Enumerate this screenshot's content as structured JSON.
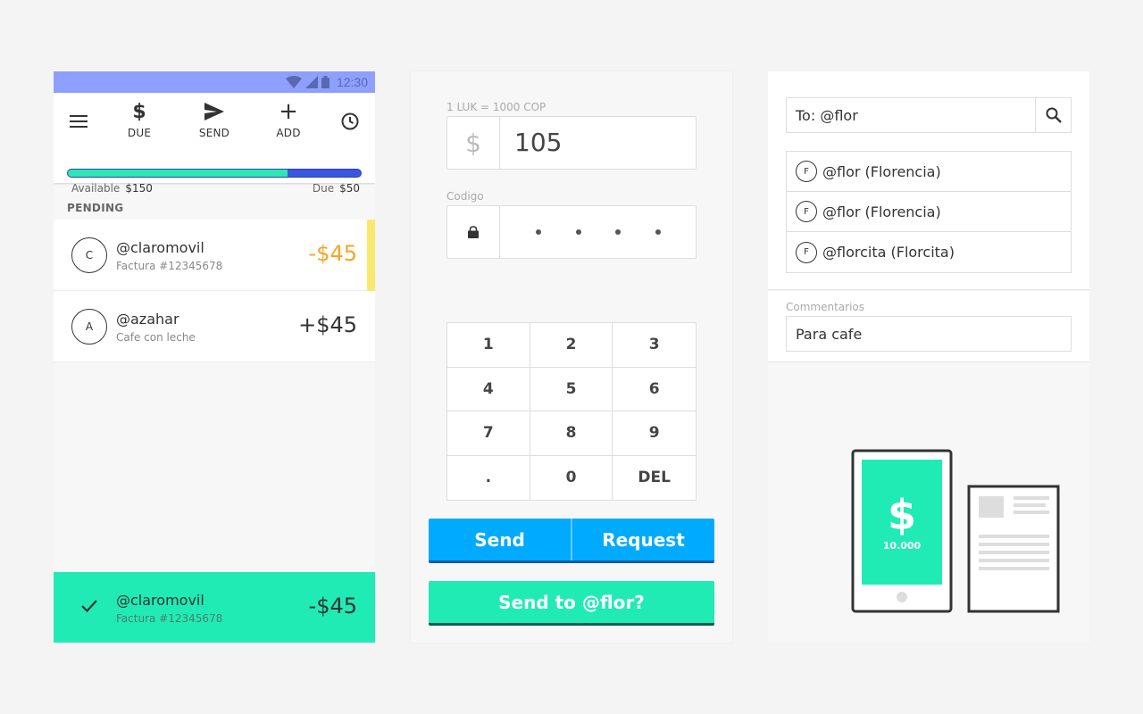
{
  "status_bar": {
    "time": "12:30"
  },
  "balance_screen": {
    "actions": [
      {
        "icon": "dollar-icon",
        "glyph": "$",
        "label": "DUE"
      },
      {
        "icon": "send-icon",
        "label": "SEND"
      },
      {
        "icon": "plus-icon",
        "glyph": "+",
        "label": "ADD"
      }
    ],
    "available_label": "Available",
    "available_value": "$150",
    "due_label": "Due",
    "due_value": "$50",
    "progress_fraction": 0.75,
    "section_label": "PENDING",
    "transactions": [
      {
        "avatar": "C",
        "handle": "@claromovil",
        "desc": "Factura #12345678",
        "amount": "-$45"
      },
      {
        "avatar": "A",
        "handle": "@azahar",
        "desc": "Cafe con leche",
        "amount": "+$45"
      }
    ],
    "toast": {
      "handle": "@claromovil",
      "desc": "Factura #12345678",
      "amount": "-$45"
    },
    "colors": {
      "status": "#8ea0ff",
      "progress_fill": "#2ee5b5",
      "progress_bg": "#3a55e0",
      "pending_marker": "#f9ea6e",
      "negative": "#f5a623",
      "toast": "#20ebb5"
    }
  },
  "send_screen": {
    "rate_label": "1 LUK = 1000 COP",
    "currency_symbol": "$",
    "amount": "105",
    "code_label": "Codigo",
    "keys": [
      "1",
      "2",
      "3",
      "4",
      "5",
      "6",
      "7",
      "8",
      "9",
      ".",
      "0",
      "DEL"
    ],
    "send_label": "Send",
    "request_label": "Request",
    "confirm_label": "Send to @flor?",
    "colors": {
      "primary": "#00aaff",
      "confirm": "#20ebb5"
    }
  },
  "recipient_screen": {
    "to_value": "To: @flor",
    "suggestions": [
      {
        "avatar": "F",
        "name": "@flor (Florencia)"
      },
      {
        "avatar": "F",
        "name": "@flor (Florencia)"
      },
      {
        "avatar": "F",
        "name": "@florcita (Florcita)"
      }
    ],
    "comments_label": "Commentarios",
    "comment_value": "Para cafe",
    "illustration": {
      "symbol": "$",
      "amount": "10.000"
    }
  }
}
